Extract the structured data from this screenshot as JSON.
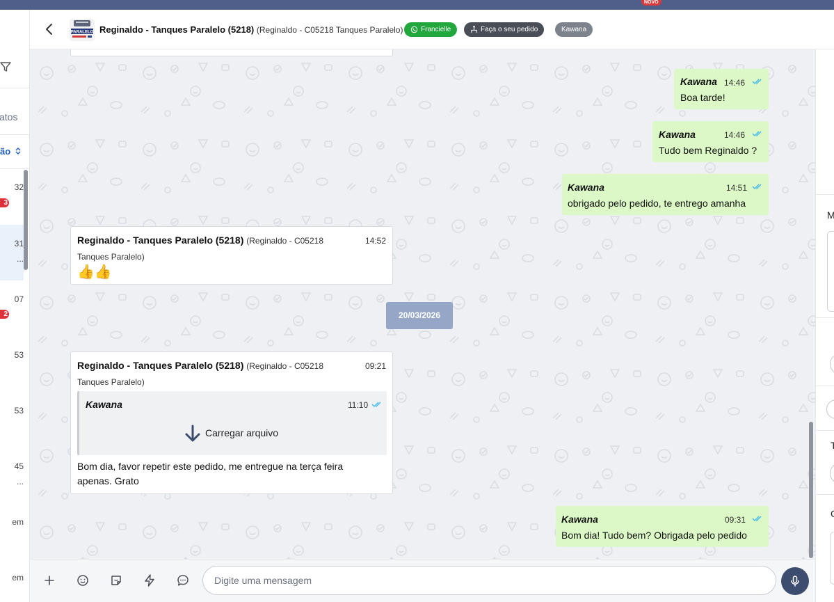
{
  "topbar": {
    "novo_badge": "NOVO"
  },
  "left_panel": {
    "tab_fragment": "atos",
    "sort_fragment": "ão",
    "items": [
      {
        "time": "32",
        "badge": "3",
        "ellipsis": ""
      },
      {
        "time": "31",
        "badge": "",
        "ellipsis": "..."
      },
      {
        "time": "07",
        "badge": "2",
        "ellipsis": ""
      },
      {
        "time": "53",
        "badge": "",
        "ellipsis": ""
      },
      {
        "time": "53",
        "badge": "",
        "ellipsis": ""
      },
      {
        "time": "45",
        "badge": "",
        "ellipsis": "..."
      },
      {
        "time": "em",
        "badge": "",
        "ellipsis": ""
      },
      {
        "time": "em",
        "badge": "",
        "ellipsis": ""
      }
    ]
  },
  "header": {
    "contact_name": "Reginaldo - Tanques Paralelo (5218)",
    "contact_sub": "(Reginaldo - C05218 Tanques Paralelo)",
    "chip_whatsapp": "Francielle",
    "chip_order": "Faça o seu pedido",
    "chip_agent": "Kawana",
    "avatar_text": "PARALELO"
  },
  "messages": {
    "m1": {
      "sender": "Kawana",
      "time": "14:46",
      "text": "Boa tarde!"
    },
    "m2": {
      "sender": "Kawana",
      "time": "14:46",
      "text": "Tudo bem Reginaldo ?"
    },
    "m3": {
      "sender": "Kawana",
      "time": "14:51",
      "text": "obrigado pelo pedido, te entrego amanha"
    },
    "m4": {
      "sender": "Reginaldo - Tanques Paralelo (5218)",
      "sender_sub": "(Reginaldo - C05218",
      "sender_sub2": "Tanques Paralelo)",
      "time": "14:52",
      "text": "👍👍"
    },
    "date_separator": "20/03/2026",
    "m5": {
      "sender": "Reginaldo - Tanques Paralelo (5218)",
      "sender_sub": "(Reginaldo - C05218",
      "sender_sub2": "Tanques Paralelo)",
      "time": "09:21",
      "quote_sender": "Kawana",
      "quote_time": "11:10",
      "quote_file": "Carregar arquivo",
      "text_line1": "Bom dia, favor repetir este pedido, me entregue na terça feira",
      "text_line2": "apenas. Grato"
    },
    "m6": {
      "sender": "Kawana",
      "time": "09:31",
      "text": "Bom dia! Tudo bem? Obrigada pelo pedido"
    }
  },
  "composer": {
    "placeholder": "Digite uma mensagem"
  },
  "right_panel": {
    "letter1": "M",
    "letter2": "T",
    "letter3": "C"
  },
  "colors": {
    "accent": "#3d4d6f",
    "outgoing_bubble": "#dcf8c6",
    "whatsapp_green": "#21a73b",
    "date_pill": "#95a6c6",
    "ticks": "#34b7f1"
  }
}
